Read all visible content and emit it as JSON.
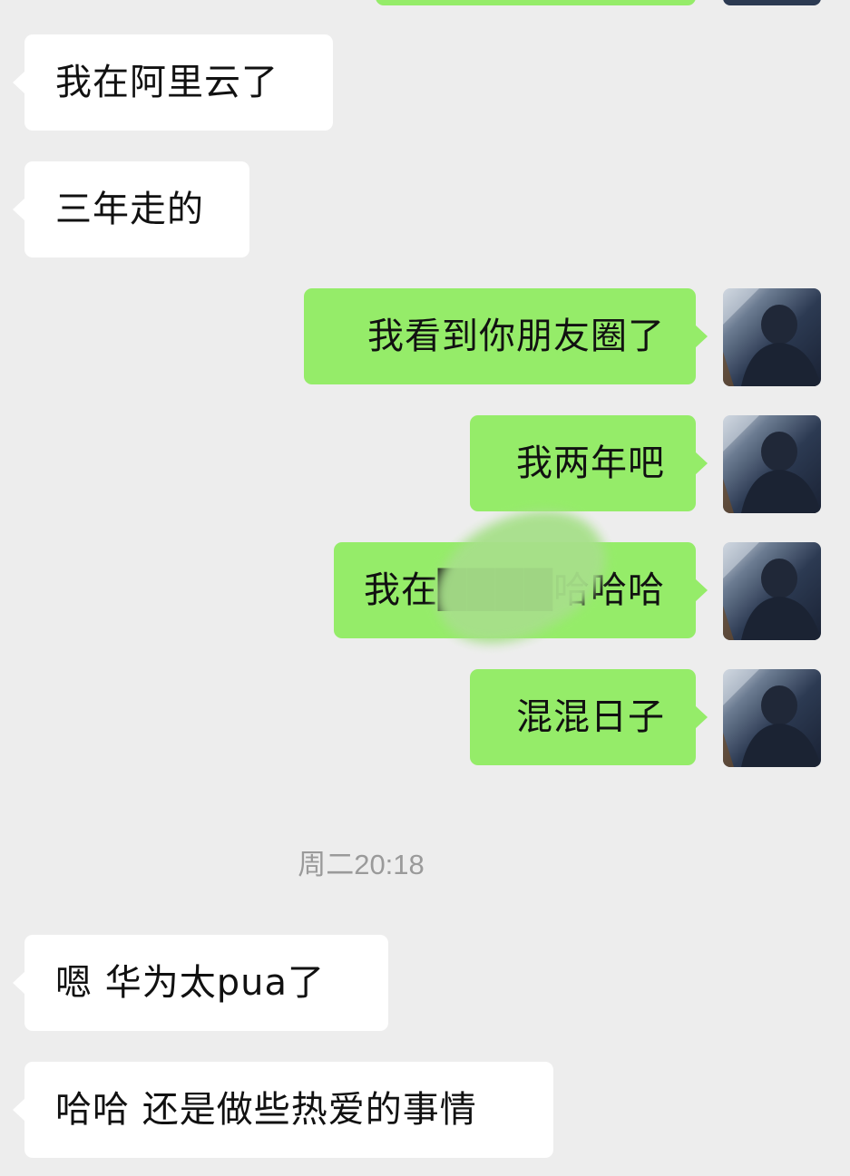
{
  "colors": {
    "background": "#ededed",
    "incoming_bubble": "#ffffff",
    "outgoing_bubble": "#95ec69",
    "timestamp_text": "#9a9a9a"
  },
  "messages_before": [
    {
      "direction": "in",
      "text": "我在阿里云了"
    },
    {
      "direction": "in",
      "text": "三年走的"
    },
    {
      "direction": "out",
      "text": "我看到你朋友圈了"
    },
    {
      "direction": "out",
      "text": "我两年吧"
    },
    {
      "direction": "out",
      "text": "我在████哈哈哈"
    },
    {
      "direction": "out",
      "text": "混混日子"
    }
  ],
  "timestamp": "周二20:18",
  "messages_after": [
    {
      "direction": "in",
      "text": "嗯 华为太pua了"
    },
    {
      "direction": "in",
      "text": "哈哈 还是做些热爱的事情"
    }
  ],
  "avatar_icon": "user-avatar-icon"
}
